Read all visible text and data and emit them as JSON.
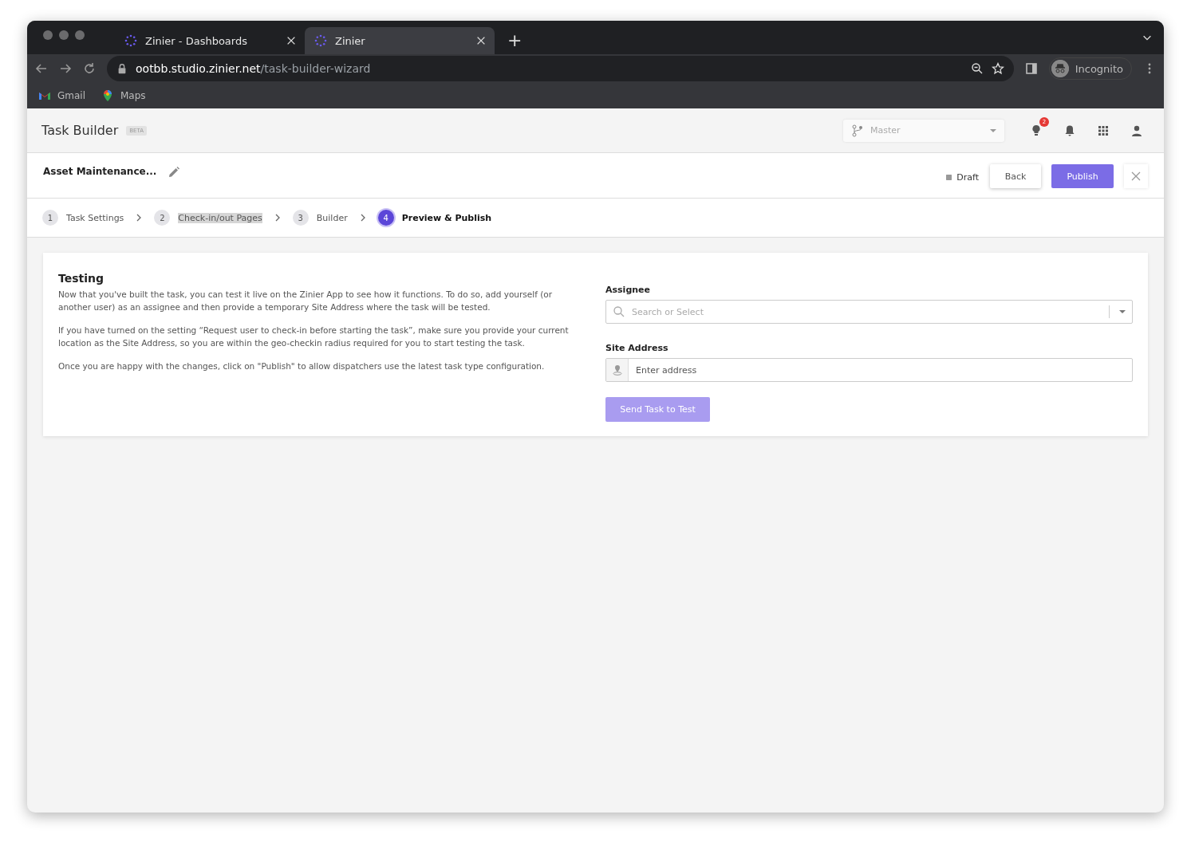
{
  "browser": {
    "tabs": [
      {
        "title": "Zinier - Dashboards",
        "selected": false
      },
      {
        "title": "Zinier",
        "selected": true
      }
    ],
    "new_tab": "+",
    "url_host": "ootbb.studio.zinier.net",
    "url_path": "/task-builder-wizard",
    "profile": "Incognito",
    "bookmarks": [
      {
        "label": "Gmail",
        "kind": "gmail"
      },
      {
        "label": "Maps",
        "kind": "maps"
      }
    ]
  },
  "app": {
    "title": "Task Builder",
    "badge": "BETA",
    "branch": {
      "placeholder": "Master"
    },
    "notification_count": "2"
  },
  "task": {
    "name": "Asset Maintenance...",
    "status": "Draft",
    "buttons": [
      {
        "label": "Back",
        "kind": "secondary"
      },
      {
        "label": "Publish",
        "kind": "primary"
      }
    ]
  },
  "steps": [
    {
      "number": "1",
      "label": "Task Settings",
      "selected": false,
      "highlighted": false
    },
    {
      "number": "2",
      "label": "Check-in/out Pages",
      "selected": false,
      "highlighted": true
    },
    {
      "number": "3",
      "label": "Builder",
      "selected": false,
      "highlighted": false
    },
    {
      "number": "4",
      "label": "Preview & Publish",
      "selected": true,
      "highlighted": false
    }
  ],
  "testing": {
    "title": "Testing",
    "paragraphs": [
      "Now that you've built the task, you can test it live on the Zinier App to see how it functions. To do so, add yourself (or another user) as an assignee and then provide a temporary Site Address where the task will be tested.",
      "If you have turned on the setting “Request user to check-in before starting the task”, make sure you provide your current location as the Site Address, so you are within the geo-checkin radius required for you to start testing the task.",
      "Once you are happy with the changes, click on \"Publish\" to allow dispatchers use the latest task type configuration."
    ],
    "assignee": {
      "label": "Assignee",
      "placeholder": "Search or Select"
    },
    "site_address": {
      "label": "Site Address",
      "placeholder": "Enter address"
    },
    "submit": {
      "label": "Send Task to Test",
      "disabled": true
    }
  }
}
